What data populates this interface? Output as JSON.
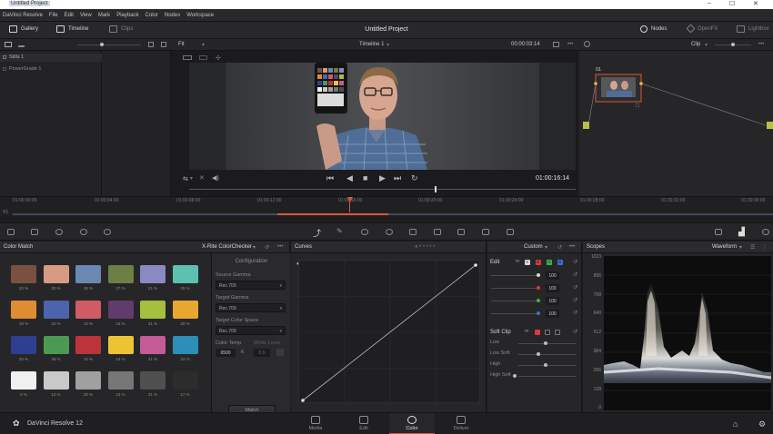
{
  "window": {
    "title": "Untitled Project",
    "controls": [
      "–",
      "☐",
      "✕"
    ]
  },
  "menu": [
    "DaVinci Resolve",
    "File",
    "Edit",
    "View",
    "Mark",
    "Playback",
    "Color",
    "Nodes",
    "Workspace"
  ],
  "toolbar": {
    "gallery": "Gallery",
    "timeline": "Timeline",
    "clips": "Clips",
    "project_title": "Untitled Project",
    "nodes": "Nodes",
    "openfx": "OpenFX",
    "lightbox": "Lightbox"
  },
  "viewer_bar": {
    "zoom": "Fit",
    "timeline_name": "Timeline 1",
    "timecode": "00:00:03:14",
    "clip_mode": "Clip"
  },
  "gallery": {
    "items": [
      "Stills 1",
      "PowerGrade 1"
    ]
  },
  "viewer": {
    "timecode": "01:00:16:14"
  },
  "node": {
    "label": "01"
  },
  "ruler": {
    "track": "V1",
    "ticks": [
      "01:00:00:00",
      "01:00:04:00",
      "01:00:08:00",
      "01:00:12:00",
      "01:00:16:00",
      "01:00:20:00",
      "01:00:24:00",
      "01:00:28:00",
      "01:00:32:00",
      "01:00:36:00"
    ]
  },
  "color_match": {
    "title": "Color Match",
    "chart": "X-Rite ColorChecker",
    "swatches": [
      {
        "color": "#7a5140",
        "label": "20 %"
      },
      {
        "color": "#d79a83",
        "label": "20 %"
      },
      {
        "color": "#6b88b3",
        "label": "26 %"
      },
      {
        "color": "#6d7f45",
        "label": "27 %"
      },
      {
        "color": "#8b89c3",
        "label": "21 %"
      },
      {
        "color": "#5cc1b0",
        "label": "29 %"
      },
      {
        "color": "#e08c32",
        "label": "19 %"
      },
      {
        "color": "#4b64ad",
        "label": "22 %"
      },
      {
        "color": "#cf5b67",
        "label": "13 %"
      },
      {
        "color": "#5f3c6b",
        "label": "16 %"
      },
      {
        "color": "#a4c03e",
        "label": "21 %"
      },
      {
        "color": "#e9a731",
        "label": "20 %"
      },
      {
        "color": "#2e3f92",
        "label": "20 %"
      },
      {
        "color": "#4c9a52",
        "label": "38 %"
      },
      {
        "color": "#bb343a",
        "label": "10 %"
      },
      {
        "color": "#ecc433",
        "label": "24 %"
      },
      {
        "color": "#c45a96",
        "label": "21 %"
      },
      {
        "color": "#2b8fb8",
        "label": "33 %"
      },
      {
        "color": "#f0f0f0",
        "label": "0 %"
      },
      {
        "color": "#c9c9c9",
        "label": "12 %"
      },
      {
        "color": "#a0a0a0",
        "label": "20 %"
      },
      {
        "color": "#777777",
        "label": "23 %"
      },
      {
        "color": "#4f4f4f",
        "label": "21 %"
      },
      {
        "color": "#2c2c2c",
        "label": "17 %"
      }
    ],
    "config_title": "Configuration",
    "source_gamma_label": "Source Gamma",
    "source_gamma": "Rec.709",
    "target_gamma_label": "Target Gamma",
    "target_gamma": "Rec.709",
    "target_space_label": "Target Color Space",
    "target_space": "Rec.709",
    "color_temp_label": "Color Temp",
    "white_level_label": "White Level",
    "color_temp": "6500",
    "unit_k": "K",
    "white_level": "0.9",
    "match_button": "Match"
  },
  "curves": {
    "title": "Curves",
    "mode": "Custom"
  },
  "edit": {
    "title": "Edit",
    "channels": [
      {
        "name": "Y",
        "color": "#d8d8d8",
        "value": "100"
      },
      {
        "name": "R",
        "color": "#d93a3a",
        "value": "100"
      },
      {
        "name": "G",
        "color": "#3ab34a",
        "value": "100"
      },
      {
        "name": "B",
        "color": "#3a6fd9",
        "value": "100"
      }
    ],
    "soft_clip": "Soft Clip",
    "soft_rows": [
      "Low",
      "Low Soft",
      "High",
      "High Soft"
    ]
  },
  "scopes": {
    "title": "Scopes",
    "mode": "Waveform",
    "levels": [
      "1023",
      "896",
      "768",
      "640",
      "512",
      "384",
      "256",
      "128",
      "0"
    ]
  },
  "footer": {
    "app": "DaVinci Resolve 12",
    "pages": [
      "Media",
      "Edit",
      "Color",
      "Deliver"
    ]
  }
}
